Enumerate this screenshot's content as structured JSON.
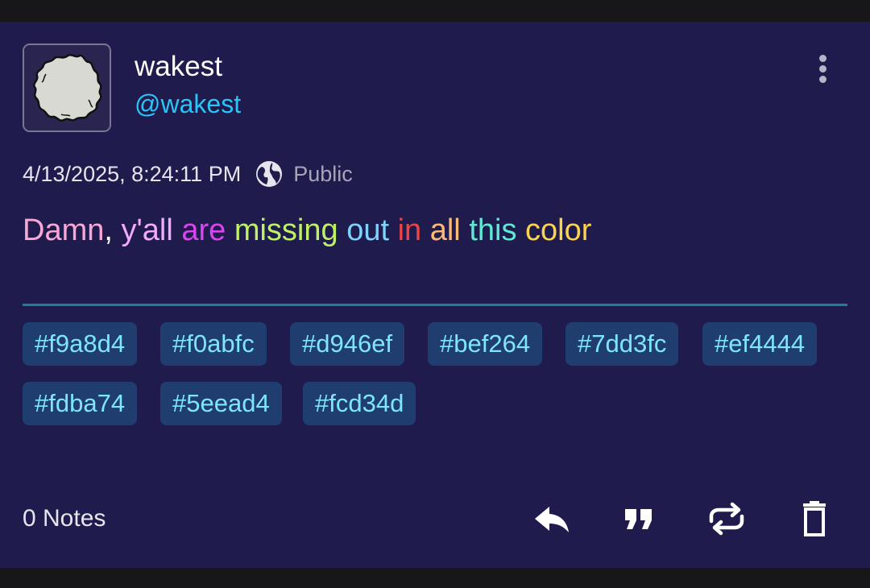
{
  "note": {
    "author": {
      "display_name": "wakest",
      "handle": "@wakest"
    },
    "timestamp": "4/13/2025, 8:24:11 PM",
    "visibility": "Public",
    "content_words": [
      {
        "text": "Damn",
        "color": "#f9a8d4"
      },
      {
        "text": ", ",
        "color": "#ffffff"
      },
      {
        "text": "y'all",
        "color": "#f0abfc"
      },
      {
        "text": " ",
        "color": "#ffffff"
      },
      {
        "text": "are",
        "color": "#d946ef"
      },
      {
        "text": " ",
        "color": "#ffffff"
      },
      {
        "text": "missing",
        "color": "#bef264"
      },
      {
        "text": " ",
        "color": "#ffffff"
      },
      {
        "text": "out",
        "color": "#7dd3fc"
      },
      {
        "text": " ",
        "color": "#ffffff"
      },
      {
        "text": "in",
        "color": "#ef4444"
      },
      {
        "text": " ",
        "color": "#ffffff"
      },
      {
        "text": "all",
        "color": "#fdba74"
      },
      {
        "text": " ",
        "color": "#ffffff"
      },
      {
        "text": "this",
        "color": "#5eead4"
      },
      {
        "text": " ",
        "color": "#ffffff"
      },
      {
        "text": "color",
        "color": "#fcd34d"
      }
    ],
    "hashtags": [
      "#f9a8d4",
      "#f0abfc",
      "#d946ef",
      "#bef264",
      "#7dd3fc",
      "#ef4444",
      "#fdba74",
      "#5eead4",
      "#fcd34d"
    ],
    "notes_count": "0 Notes",
    "actions": [
      "reply-icon",
      "quote-icon",
      "boost-icon",
      "delete-icon"
    ]
  },
  "colors": {
    "background": "#1f1b4d",
    "handle": "#29c5f6",
    "tag_background": "#1f3d6e",
    "tag_text": "#7fe4ff",
    "divider": "#1d7f91"
  }
}
